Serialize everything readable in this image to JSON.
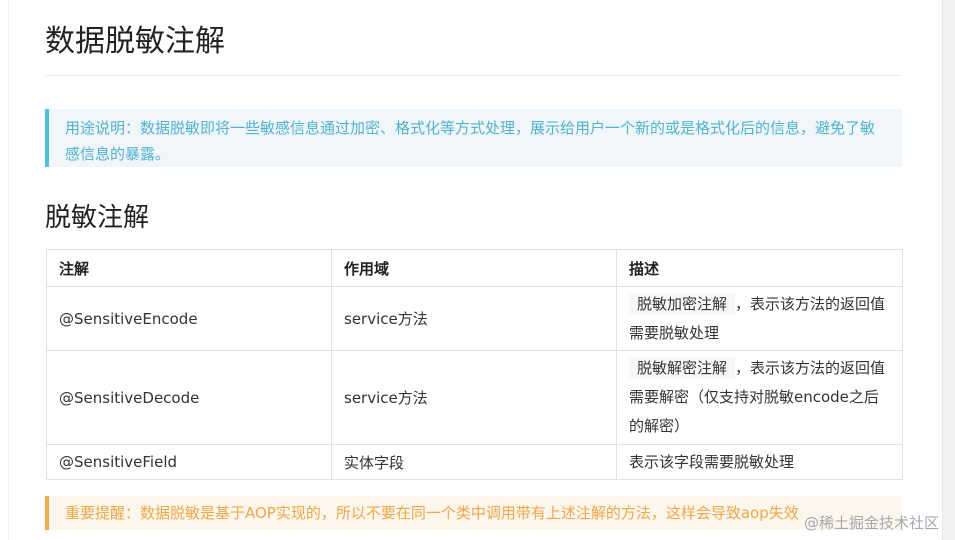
{
  "article": {
    "title": "数据脱敏注解",
    "note_info": "用途说明：数据脱敏即将一些敏感信息通过加密、格式化等方式处理，展示给用户一个新的或是格式化后的信息，避免了敏感信息的暴露。",
    "section_title": "脱敏注解",
    "table": {
      "headers": [
        "注解",
        "作用域",
        "描述"
      ],
      "rows": [
        {
          "annotation": "@SensitiveEncode",
          "scope": "service方法",
          "desc_code": "脱敏加密注解",
          "desc_text": "，表示该方法的返回值需要脱敏处理"
        },
        {
          "annotation": "@SensitiveDecode",
          "scope": "service方法",
          "desc_code": "脱敏解密注解",
          "desc_text": "，表示该方法的返回值需要解密（仅支持对脱敏encode之后的解密）"
        },
        {
          "annotation": "@SensitiveField",
          "scope": "实体字段",
          "desc_text": "表示该字段需要脱敏处理"
        }
      ]
    },
    "note_warning": "重要提醒：数据脱敏是基于AOP实现的，所以不要在同一个类中调用带有上述注解的方法，这样会导致aop失效"
  },
  "watermark": "@稀土掘金技术社区",
  "colors": {
    "info_accent": "#50bfda",
    "warning_accent": "#f0ad4e"
  }
}
